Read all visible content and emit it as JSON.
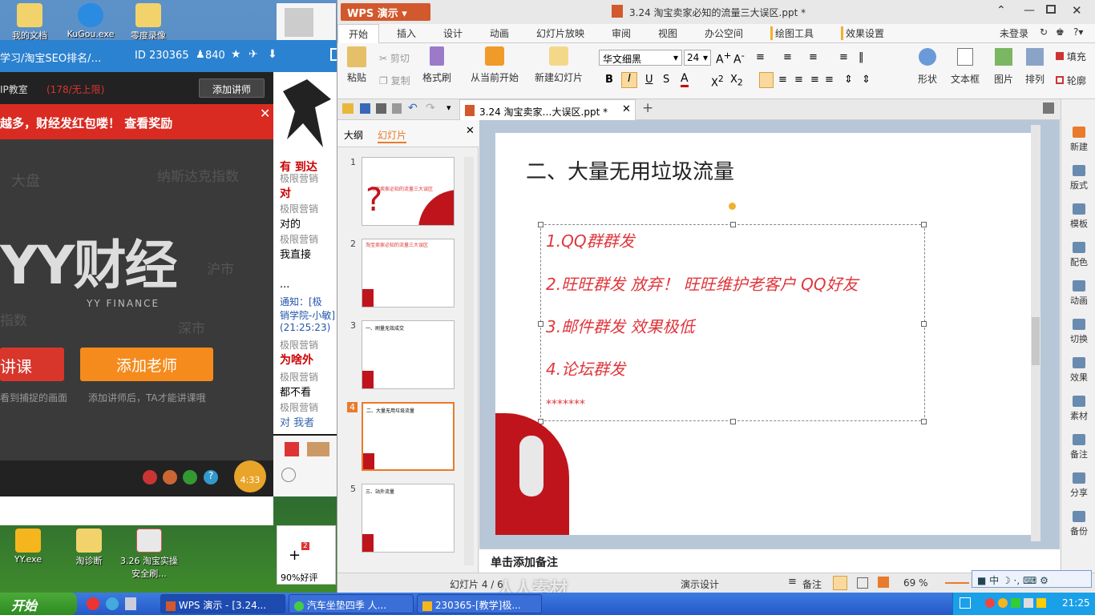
{
  "desktop": {
    "icons": [
      "我的文档",
      "KuGou.exe",
      "零度录像",
      "YY.exe",
      "淘诊断",
      "3.26 淘宝实操安全刷..."
    ]
  },
  "yy": {
    "title": "学习/淘宝SEO排名/…",
    "id_label": "ID 230365",
    "members": "840",
    "room_label": "IP教室",
    "limit": "(178/无上限)",
    "add_lecturer": "添加讲师",
    "banner": "越多，财经发红包喽！ 查看奖励",
    "logo_main": "YY财经",
    "logo_sub": "YY FINANCE",
    "bg_words": [
      "大盘",
      "纳斯达克指数",
      "沪市",
      "指数",
      "深市"
    ],
    "btn_lecture": "讲课",
    "btn_add_teacher": "添加老师",
    "hint_left": "看到捕捉的画面",
    "hint_right": "添加讲师后，TA才能讲课哦",
    "timer": "4:33"
  },
  "chat": {
    "rows": [
      {
        "name": "有 到达",
        "msg": ""
      },
      {
        "name": "极限营销",
        "msg": "对"
      },
      {
        "name": "极限营销",
        "msg": "对的"
      },
      {
        "name": "极限营销",
        "msg": "我直接"
      },
      {
        "name": "",
        "msg": "..."
      },
      {
        "name": "通知：[极",
        "msg": "销学院-小敏]"
      },
      {
        "name": "(21:25:23)",
        "msg": ""
      },
      {
        "name": "极限营销",
        "msg": "为啥外"
      },
      {
        "name": "极限营销",
        "msg": "都不看"
      },
      {
        "name": "极限营销",
        "msg": "对 我者"
      }
    ],
    "good_rate": "90%好评",
    "badge": "2"
  },
  "wps": {
    "app_button": "WPS 演示",
    "doc_title": "3.24 淘宝卖家必知的流量三大误区.ppt *",
    "menus": [
      "开始",
      "插入",
      "设计",
      "动画",
      "幻灯片放映",
      "审阅",
      "视图",
      "办公空间",
      "绘图工具",
      "效果设置"
    ],
    "login": "未登录",
    "ribbon": {
      "paste": "粘贴",
      "cut": "剪切",
      "copy": "复制",
      "format_painter": "格式刷",
      "from_current": "从当前开始",
      "new_slide": "新建幻灯片",
      "font": "华文细黑",
      "size": "24",
      "shape": "形状",
      "textbox": "文本框",
      "picture": "图片",
      "arrange": "排列",
      "fill": "填充",
      "outline": "轮廓"
    },
    "doc_tab": "3.24 淘宝卖家…大误区.ppt *",
    "panel_tabs": [
      "大纲",
      "幻灯片"
    ],
    "thumbs": [
      {
        "num": "1",
        "title": "淘宝卖家必知的流量三大误区"
      },
      {
        "num": "2",
        "title": "淘宝卖家必知的流量三大误区"
      },
      {
        "num": "3",
        "title": "一、刷量无效成交"
      },
      {
        "num": "4",
        "title": "二、大量无用垃圾流量"
      },
      {
        "num": "5",
        "title": "三、站外流量"
      }
    ],
    "slide": {
      "heading": "二、大量无用垃圾流量",
      "lines": [
        "1.QQ群群发",
        "2.旺旺群发  放弃！ 旺旺维护老客户   QQ好友",
        "3.邮件群发  效果极低",
        "4.论坛群发",
        "*******"
      ]
    },
    "notes_placeholder": "单击添加备注",
    "right_tools": [
      "新建",
      "版式",
      "模板",
      "配色",
      "动画",
      "切换",
      "效果",
      "素材",
      "备注",
      "分享",
      "备份"
    ],
    "status": {
      "slide_label": "幻灯片 4 / 6",
      "design": "演示设计",
      "notes": "备注",
      "zoom": "69 %"
    }
  },
  "taskbar": {
    "start": "开始",
    "tasks": [
      "WPS 演示 - [3.24...",
      "汽车坐垫四季 人...",
      "230365-[教学]极..."
    ],
    "clock": "21:25"
  },
  "watermark": "人人素材"
}
